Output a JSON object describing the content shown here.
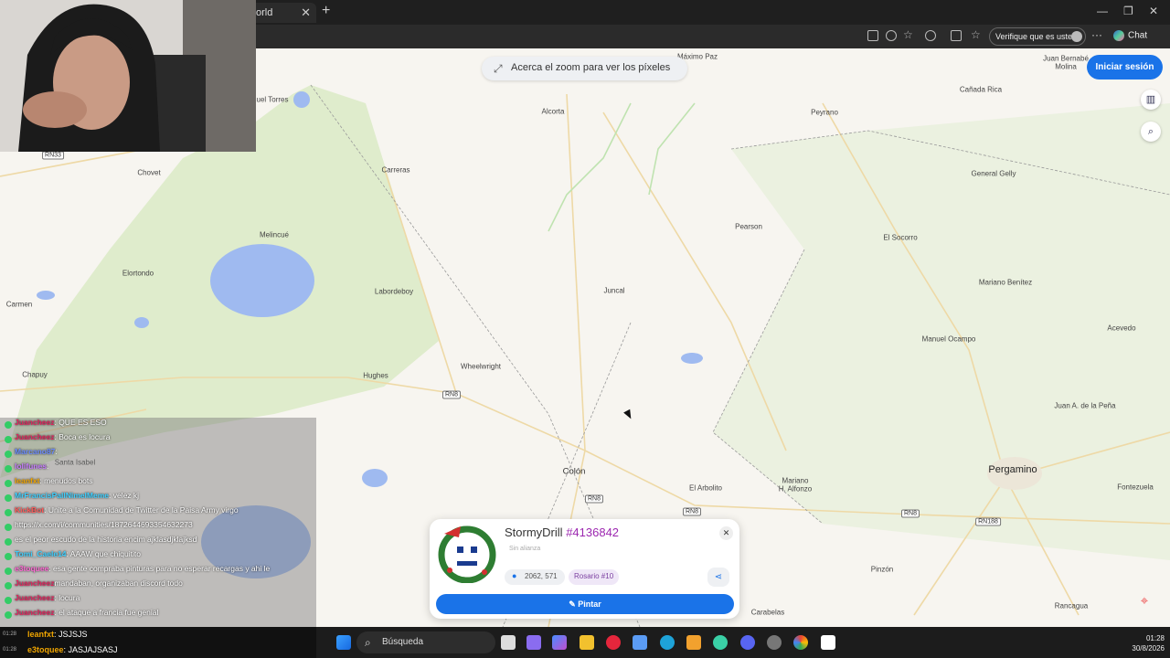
{
  "browser": {
    "tab_title": "orld",
    "verify_label": "Verifique que es usted",
    "chat_label": "Chat"
  },
  "map": {
    "zoom_hint": "Acerca el zoom para ver los píxeles",
    "login_label": "Iniciar sesión",
    "places": {
      "maximo_paz": "Máximo Paz",
      "juan_bernabe": "Juan Bernabé",
      "molina": "Molina",
      "miguel_torres": "uel Torres",
      "alcorta": "Alcorta",
      "peyrano": "Peyrano",
      "canada_rica": "Cañada Rica",
      "carreras": "Carreras",
      "chovet": "Chovet",
      "general_gelly": "General Gelly",
      "pearson": "Pearson",
      "melincue": "Melincué",
      "el_socorro": "El Socorro",
      "elortondo": "Elortondo",
      "labordeboy": "Labordeboy",
      "juncal": "Juncal",
      "mariano_benitez": "Mariano Benítez",
      "carmen": "Carmen",
      "acevedo": "Acevedo",
      "manuel_ocampo": "Manuel Ocampo",
      "chapuy": "Chapuy",
      "hughes": "Hughes",
      "wheelwright": "Wheelwright",
      "juan_a_de_la_pena": "Juan A. de la Peña",
      "colon": "Colón",
      "el_arbolito": "El Arbolito",
      "mariano_h_alfonzo_1": "Mariano",
      "mariano_h_alfonzo_2": "H. Alfonzo",
      "pergamino": "Pergamino",
      "fontezuela": "Fontezuela",
      "pinzon": "Pinzón",
      "carabelas": "Carabelas",
      "rancagua": "Rancagua",
      "santa_isabel": "Santa Isabel"
    },
    "roads": {
      "rn33": "RN33",
      "rn8a": "RN8",
      "rn8b": "RN8",
      "rn8c": "RN8",
      "rn8d": "RN8",
      "rn188": "RN188"
    }
  },
  "chat": [
    {
      "user": "Juancheez",
      "text": ": QUE ES ESO",
      "color": "#e0245e"
    },
    {
      "user": "Juancheez",
      "text": ": Boca es locura",
      "color": "#e0245e"
    },
    {
      "user": "Marcano87",
      "text": ": ",
      "color": "#6b8cff"
    },
    {
      "user": "lolifunes",
      "text": ": ",
      "color": "#c77dff"
    },
    {
      "user": "leanfxt",
      "text": ": menudos bots",
      "color": "#f0a500"
    },
    {
      "user": "MrFrancisPallNimelMeme",
      "text": ": velez kj",
      "color": "#3fd0ff"
    },
    {
      "user": "KickBot",
      "text": ": Unite a la Comunidad de Twitter de la Paisa Army virgo",
      "color": "#ff5a5a"
    },
    {
      "user": "",
      "text": "https://x.com/i/communities/1872644693354632273",
      "color": "#8ab4ff"
    },
    {
      "user": "",
      "text": "es el peor escudo de la historia encim ajklasdjklajksd",
      "color": "#fff"
    },
    {
      "user": "Tomi_Caele14",
      "text": ": AAAW que chiquitito",
      "color": "#3fd0ff"
    },
    {
      "user": "e3toquee",
      "text": ": esa gente compraba pinturas para no esperar recargas y ahi le",
      "color": "#ff6ad5"
    },
    {
      "user": "Juancheez",
      "text": "mandaban, organizaban discord todo",
      "color": "#e0245e"
    },
    {
      "user": "Juancheez",
      "text": ": locura",
      "color": "#e0245e"
    },
    {
      "user": "Juancheez",
      "text": ": el ataque a francia fue genial",
      "color": "#e0245e"
    }
  ],
  "bottom_chat": [
    {
      "time": "01:28",
      "user": "leanfxt",
      "text": ": JSJSJS"
    },
    {
      "time": "01:28",
      "user": "e3toquee",
      "text": ": JASJAJSASJ"
    }
  ],
  "card": {
    "username": "StormyDrill",
    "user_id": "#4136842",
    "alliance": "Sin alianza",
    "coords": "2062, 571",
    "region": "Rosario #10",
    "paint_label": "Pintar"
  },
  "taskbar": {
    "search_label": "Búsqueda",
    "time": "01:28",
    "date": "30/8/2026"
  }
}
